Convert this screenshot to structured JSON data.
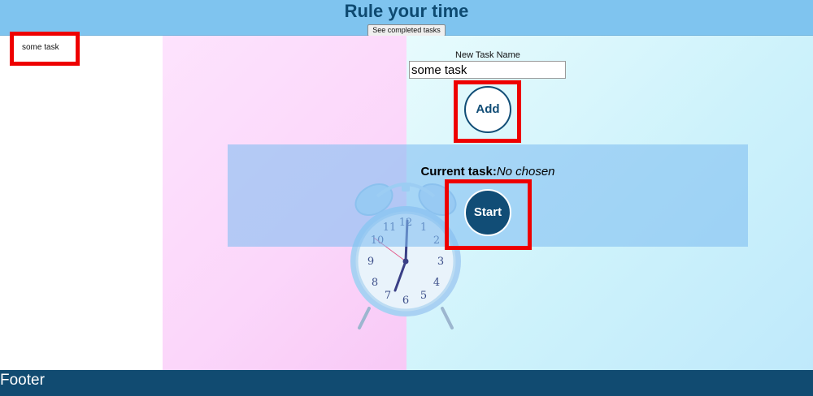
{
  "header": {
    "title": "Rule your time",
    "completed_button_label": "See completed tasks",
    "background_color": "#7fc4ef",
    "title_color": "#0e4a71"
  },
  "sidebar": {
    "tasks": [
      {
        "label": "some task"
      }
    ]
  },
  "new_task": {
    "label": "New Task Name",
    "input_value": "some task",
    "add_button_label": "Add"
  },
  "current_task": {
    "label": "Current task:",
    "value": "No chosen",
    "start_button_label": "Start"
  },
  "footer": {
    "text": "Footer",
    "background_color": "#114b71"
  },
  "illustration": {
    "icon": "alarm-clock-icon",
    "clock_numerals": [
      "12",
      "1",
      "2",
      "3",
      "4",
      "5",
      "6",
      "7",
      "8",
      "9",
      "10",
      "11"
    ]
  },
  "colors": {
    "highlight_frame": "#ee0000",
    "accent": "#114d76"
  }
}
